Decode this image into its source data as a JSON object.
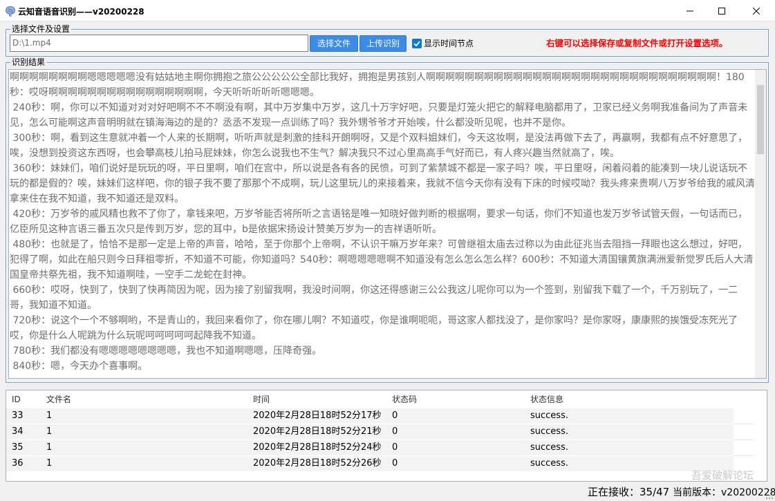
{
  "window": {
    "title": "云知音语音识别——v20200228",
    "icon": "brain-icon"
  },
  "settings": {
    "legend": "选择文件及设置",
    "file_path": "D:\\1.mp4",
    "choose_button": "选择文件",
    "upload_button": "上传识别",
    "show_timestamps_label": "显示时间节点",
    "show_timestamps_checked": true,
    "hint": "右键可以选择保存或复制文件或打开设置选项。",
    "hint_color": "#ff0000",
    "button_color": "#3c8ce7"
  },
  "result": {
    "legend": "识别结果",
    "text": "啊啊啊啊啊啊啊啊嗯嗯嗯嗯嗯没有姑姑地主啊你拥抱之旅公公公公公全部比我好，拥抱是男孩别人啊啊啊啊啊啊啊啊啊啊啊啊啊啊啊啊啊啊啊啊啊啊啊啊啊啊啊啊啊啊！180秒：哎呀啊啊啊啊啊啊啊啊啊啊啊啊啊啊啊啊，今天听听听听听嗯嗯嗯。\n 240秒：啊，你可以不知道对对对好吧啊不不不啊没有啊，其中万岁集中万岁，这几十万字好吧，只要是灯笼火把它的解释电脑都用了，卫家已经义务啊我准备间为了声音未见，怎么可能啊这声音明明就在镇海海边的是的？丞丞不发现一点训练了吗？我外甥爷爷才开始唉，什么都没听见呢，也并不是你。\n 300秒：啊，看到这生意就冲着一个人来的长期啊，听听声就是刺激的挂科开朗啊呀，又是个双料姐妹们，今天这妆啊，是没法再做下去了，再赢啊，我都有点不好意思了，唉，没想到投资这东西呀，也会攀高枝儿拍马屁妹妹，你怎么说我也不生气？解决我只不过心里高高手气好而已，有人疼兴趣当然就高了，唉。\n 360秒：妹妹们，咱们说好是玩玩的呀，平日里啊，咱们在宫中，所以说是各有各的民愤，可到了紫禁城不都是一家子吗？唉，平日里呀，闲着闷着的能凑到一块儿说话玩不玩的都是假的？唉，妹妹们这样吧，你的银子我不要了那那个不成啊，玩儿这里玩儿的来接着来，我就不信今天你有没有下床的时候哎呦？我头疼来贵啊八万岁爷给我的戚风清拿来住在我不知道，我不知道还是双料。\n 420秒：万岁爷的戚风精也救不了你了，拿钱来吧，万岁爷能否将所听之言语铭是唯一知晓好做判断的根据啊，要求一句话，你们不知道也发万岁爷试管天假，一句话而已，亿臣所见这种言语三番五次只是传到万岁，您的耳中，b是依据宋扬设计赞美万岁为一的吉祥语听听。\n 480秒：也就是了，恰恰不是那一定是上帝的声音，哈哈，至于你那个上帝啊，不认识干嘛万岁年来？可曾继祖太庙去过称以为由此征兆当去阻挡一拜眼也这么想过，好吧，犯得了啊，如此在船只则今日拜祖零折，不知道不可能，你知道吗？540秒：啊嗯嗯嗯嗯啊不知道没有怎么怎么怎么样？600秒：不知道大清国镶黄旗满洲爱新觉罗氏后人大清国皇帝共祭先祖，我不知道啊哇，一空手二龙蛇在封神。\n 660秒：哎呀，快到了，快到了快再简因为呢，因为接了别留我啊，我没时间啊，你这还得感谢三公公我这儿呢你可以为一个签到，别留我下载了一个，千万别玩了，一二哥，我知道不知道。\n 720秒：说这个一个不够啊哟，不是青山的，我回来看你了，你在哪儿啊？不知道哎，你是谁啊呃呃，哥这家人都找没了，是你家吗？是你家呀，康康熙的挨饿受冻死光了哎，你是什么人呢跳为什么玩呢呵呵呵呵呵起降我不知道。\n 780秒：我们都没有嗯嗯嗯嗯嗯嗯嗯嗯，我也不知道啊嗯嗯，压降奇强。\n 840秒：嗯，今天办个喜事啊。"
  },
  "table": {
    "columns": [
      "ID",
      "文件名",
      "时间",
      "状态码",
      "状态信息"
    ],
    "rows": [
      {
        "id": "33",
        "name": "1",
        "time": "2020年2月28日18时52分17秒",
        "code": "0",
        "msg": "success."
      },
      {
        "id": "34",
        "name": "1",
        "time": "2020年2月28日18时52分21秒",
        "code": "0",
        "msg": "success."
      },
      {
        "id": "35",
        "name": "1",
        "time": "2020年2月28日18时52分24秒",
        "code": "0",
        "msg": "success."
      },
      {
        "id": "36",
        "name": "1",
        "time": "2020年2月28日18时52分26秒",
        "code": "0",
        "msg": "success."
      }
    ]
  },
  "status": {
    "receiving": "正在接收：35/47",
    "version": "当前版本：v20200228",
    "watermark": "吾爱破解论坛"
  }
}
